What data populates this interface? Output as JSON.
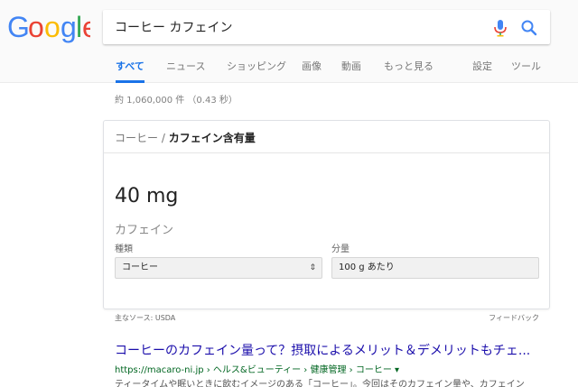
{
  "logo": {
    "letters": [
      {
        "char": "G",
        "color": "#4285F4"
      },
      {
        "char": "o",
        "color": "#EA4335"
      },
      {
        "char": "o",
        "color": "#FBBC05"
      },
      {
        "char": "g",
        "color": "#4285F4"
      },
      {
        "char": "l",
        "color": "#34A853"
      },
      {
        "char": "e",
        "color": "#EA4335"
      }
    ]
  },
  "search": {
    "query": "コーヒー カフェイン",
    "mic_icon": "microphone-icon",
    "search_icon": "magnifier-icon",
    "accent": "#4285F4"
  },
  "tabs": [
    {
      "label": "すべて",
      "active": true
    },
    {
      "label": "ニュース",
      "active": false
    },
    {
      "label": "ショッピング",
      "active": false
    },
    {
      "label": "画像",
      "active": false
    },
    {
      "label": "動画",
      "active": false
    },
    {
      "label": "もっと見る",
      "active": false
    },
    {
      "label": "設定",
      "active": false
    },
    {
      "label": "ツール",
      "active": false
    }
  ],
  "stats": "約 1,060,000 件 （0.43 秒）",
  "card": {
    "breadcrumb_prefix": "コーヒー / ",
    "breadcrumb_title": "カフェイン含有量",
    "value": "40 mg",
    "value_label": "カフェイン",
    "type_label": "種類",
    "type_value": "コーヒー",
    "amount_label": "分量",
    "amount_value": "100 g あたり"
  },
  "source": "主なソース: USDA",
  "feedback": "フィードバック",
  "result": {
    "title": "コーヒーのカフェイン量って？摂取によるメリット＆デメリットもチェ...",
    "url": "https://macaro-ni.jp › ヘルス&ビューティー › 健康管理 › コーヒー ▾",
    "snippet": "ティータイムや眠いときに飲むイメージのある「コーヒー」。今回はそのカフェイン量や、カフェイン"
  }
}
